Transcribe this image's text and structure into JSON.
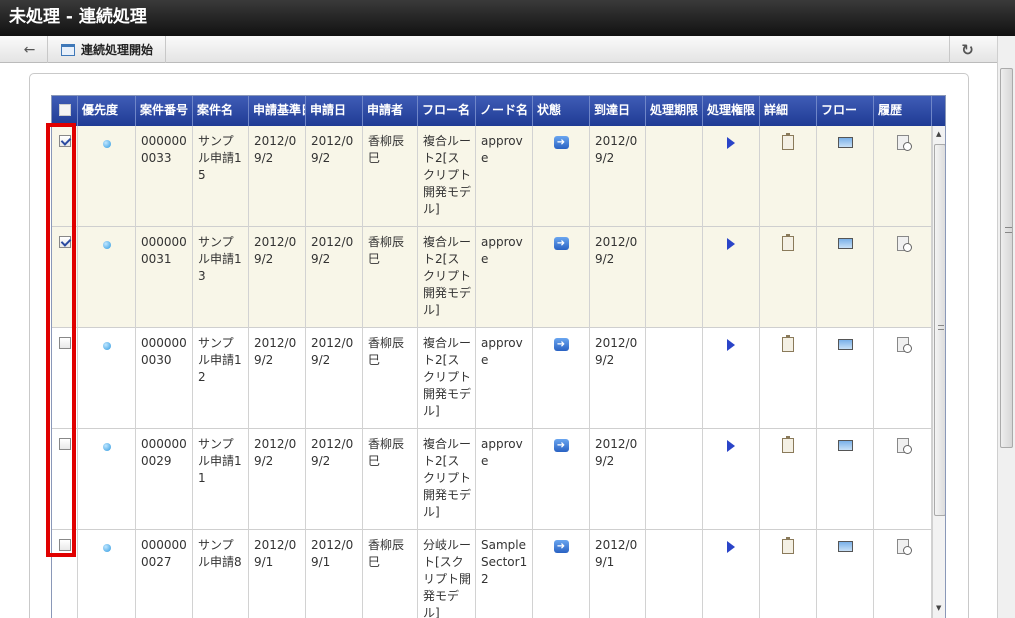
{
  "window": {
    "title": "未処理 - 連続処理"
  },
  "toolbar": {
    "back_label": "",
    "start_label": "連続処理開始"
  },
  "columns": [
    "",
    "優先度",
    "案件番号",
    "案件名",
    "申請基準日",
    "申請日",
    "申請者",
    "フロー名",
    "ノード名",
    "状態",
    "到達日",
    "処理期限",
    "処理権限",
    "詳細",
    "フロー",
    "履歴"
  ],
  "rows": [
    {
      "checked": true,
      "number": "0000000033",
      "name": "サンプル申請15",
      "base_date": "2012/09/2",
      "apply_date": "2012/09/2",
      "applicant": "香柳辰巳",
      "flow": "複合ルート2[スクリプト開発モデル]",
      "node": "approve",
      "arrival": "2012/09/2"
    },
    {
      "checked": true,
      "number": "0000000031",
      "name": "サンプル申請13",
      "base_date": "2012/09/2",
      "apply_date": "2012/09/2",
      "applicant": "香柳辰巳",
      "flow": "複合ルート2[スクリプト開発モデル]",
      "node": "approve",
      "arrival": "2012/09/2"
    },
    {
      "checked": false,
      "number": "0000000030",
      "name": "サンプル申請12",
      "base_date": "2012/09/2",
      "apply_date": "2012/09/2",
      "applicant": "香柳辰巳",
      "flow": "複合ルート2[スクリプト開発モデル]",
      "node": "approve",
      "arrival": "2012/09/2"
    },
    {
      "checked": false,
      "number": "0000000029",
      "name": "サンプル申請11",
      "base_date": "2012/09/2",
      "apply_date": "2012/09/2",
      "applicant": "香柳辰巳",
      "flow": "複合ルート2[スクリプト開発モデル]",
      "node": "approve",
      "arrival": "2012/09/2"
    },
    {
      "checked": false,
      "number": "0000000027",
      "name": "サンプル申請8",
      "base_date": "2012/09/1",
      "apply_date": "2012/09/1",
      "applicant": "香柳辰巳",
      "flow": "分岐ルート[スクリプト開発モデル]",
      "node": "Sample Sector12",
      "arrival": "2012/09/1"
    }
  ],
  "icons": {
    "back": "arrow-left-icon",
    "start": "window-icon",
    "refresh": "refresh-icon",
    "priority": "priority-dot-icon",
    "status": "arrow-right-icon",
    "process": "play-icon",
    "detail": "clipboard-icon",
    "flow": "picture-icon",
    "history": "history-icon"
  },
  "colors": {
    "header": "#1f3b94",
    "selected_row": "#f8f6e8",
    "highlight": "#e00000"
  }
}
